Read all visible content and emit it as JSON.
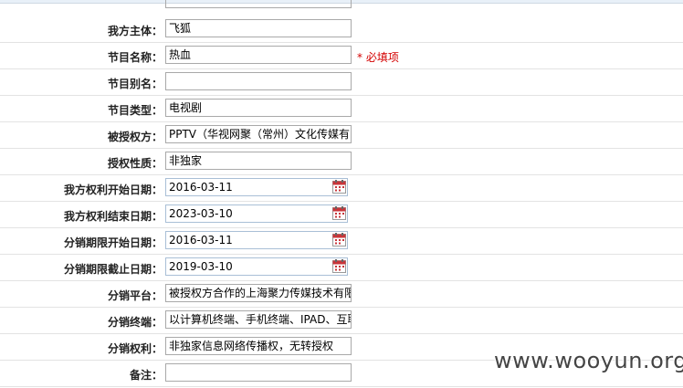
{
  "fields": [
    {
      "label": "我方主体：",
      "value": "飞狐"
    },
    {
      "label": "节目名称：",
      "value": "热血",
      "required": "* 必填项"
    },
    {
      "label": "节目别名：",
      "value": ""
    },
    {
      "label": "节目类型：",
      "value": "电视剧"
    },
    {
      "label": "被授权方：",
      "value": "PPTV（华视网聚（常州）文化传媒有限"
    },
    {
      "label": "授权性质：",
      "value": "非独家"
    },
    {
      "label": "我方权利开始日期：",
      "value": "2016-03-11"
    },
    {
      "label": "我方权利结束日期：",
      "value": "2023-03-10"
    },
    {
      "label": "分销期限开始日期：",
      "value": "2016-03-11"
    },
    {
      "label": "分销期限截止日期：",
      "value": "2019-03-10"
    },
    {
      "label": "分销平台：",
      "value": "被授权方合作的上海聚力传媒技术有限"
    },
    {
      "label": "分销终端：",
      "value": "以计算机终端、手机终端、IPAD、互联"
    },
    {
      "label": "分销权利：",
      "value": "非独家信息网络传播权，无转授权"
    },
    {
      "label": "备注：",
      "value": ""
    }
  ],
  "watermark": "www.wooyun.org",
  "icons": {
    "calendar": "calendar-icon"
  },
  "colors": {
    "required": "#d40000",
    "calendar": "#c8353a"
  }
}
